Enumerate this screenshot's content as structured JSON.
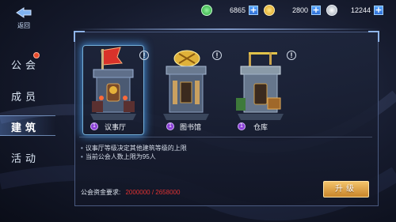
{
  "header": {
    "back_label": "返回",
    "resources": [
      {
        "icon": "green-gem-icon",
        "value": "6865",
        "color": "#4ccf58"
      },
      {
        "icon": "gold-coin-icon",
        "value": "2800",
        "color": "#f2c531"
      },
      {
        "icon": "silver-coin-icon",
        "value": "12244",
        "color": "#cfd6de"
      }
    ],
    "plus_glyph": "+"
  },
  "sidebar": {
    "items": [
      {
        "label": "公会",
        "badge": true,
        "active": false
      },
      {
        "label": "成员",
        "badge": false,
        "active": false
      },
      {
        "label": "建筑",
        "badge": false,
        "active": true
      },
      {
        "label": "活动",
        "badge": false,
        "active": false
      }
    ]
  },
  "buildings": [
    {
      "name": "议事厅",
      "level": "1",
      "selected": true
    },
    {
      "name": "图书馆",
      "level": "1",
      "selected": false
    },
    {
      "name": "仓库",
      "level": "1",
      "selected": false
    }
  ],
  "info_glyph": "!",
  "details": {
    "bullets": [
      "议事厅等级决定其他建筑等级的上限",
      "当前公会人数上限为95人"
    ],
    "funds_label": "公会资金要求:",
    "funds_value": "2000000 / 2658000",
    "funds_value_color": "#e03232"
  },
  "upgrade_button": {
    "label": "升级"
  }
}
